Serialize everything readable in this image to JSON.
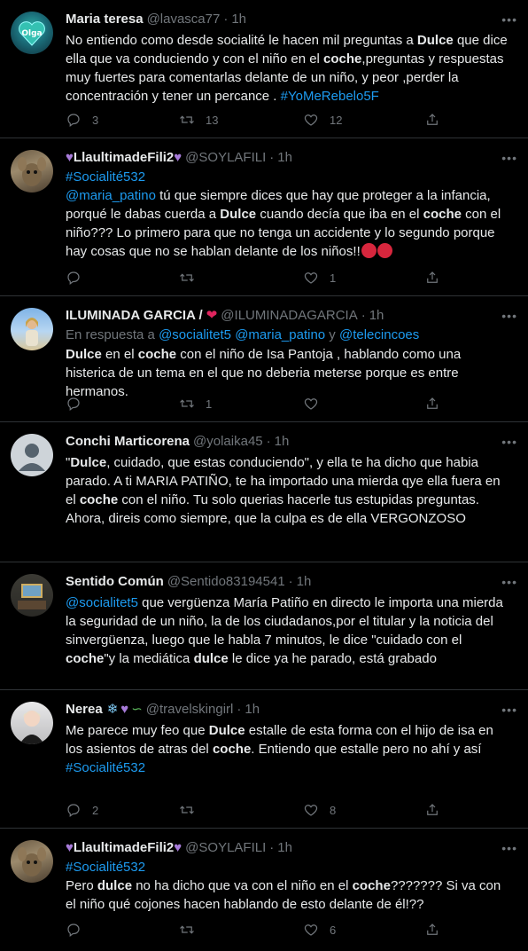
{
  "tweets": [
    {
      "name": "Maria teresa",
      "handle": "@lavasca77",
      "time": "1h",
      "reply_to": null,
      "text_parts": [
        {
          "t": "No entiendo como desde socialité le hacen mil preguntas a "
        },
        {
          "t": "Dulce",
          "b": true
        },
        {
          "t": " que dice ella que va conduciendo y con el niño en el "
        },
        {
          "t": "coche",
          "b": true
        },
        {
          "t": ",preguntas y respuestas muy fuertes para comentarlas delante de un niño, y peor ,perder la concentración y tener un percance . "
        },
        {
          "t": "#YoMeRebelo5F",
          "link": true
        }
      ],
      "replies": "3",
      "retweets": "13",
      "likes": "12"
    },
    {
      "name": "LlaultimadeFili2",
      "name_prefix_icon": "purple-heart",
      "name_suffix_icon": "purple-heart",
      "handle": "@SOYLAFILI",
      "time": "1h",
      "reply_to": null,
      "text_parts": [
        {
          "t": "#Socialité532",
          "link": true,
          "br": true
        },
        {
          "t": "@maria_patino",
          "link": true
        },
        {
          "t": " tú que siempre dices que hay que proteger a la infancia, porqué le dabas cuerda a "
        },
        {
          "t": "Dulce",
          "b": true
        },
        {
          "t": " cuando decía que iba en el "
        },
        {
          "t": "coche",
          "b": true
        },
        {
          "t": " con el niño??? Lo primero para que no tenga un accidente y lo segundo porque hay cosas que no se hablan delante de los niños!!"
        }
      ],
      "trailing_emoji": "angry-face x2",
      "replies": "",
      "retweets": "",
      "likes": "1"
    },
    {
      "name": "ILUMINADA GARCIA /",
      "name_suffix_icon": "red-heart",
      "handle": "@ILUMINADAGARCIA",
      "time": "1h",
      "reply_to": {
        "prefix": "En respuesta a ",
        "users": [
          "@socialitet5",
          "@maria_patino",
          "@telecincoes"
        ],
        "sep": " ",
        "and": " y "
      },
      "text_parts": [
        {
          "t": "Dulce",
          "b": true
        },
        {
          "t": " en el "
        },
        {
          "t": "coche",
          "b": true
        },
        {
          "t": " con el niño de Isa Pantoja , hablando como una histerica de un tema en el  que no deberia meterse porque es entre hermanos."
        }
      ],
      "replies": "",
      "retweets": "1",
      "likes": ""
    },
    {
      "name": "Conchi Marticorena",
      "handle": "@yolaika45",
      "time": "1h",
      "reply_to": null,
      "text_parts": [
        {
          "t": "\""
        },
        {
          "t": "Dulce",
          "b": true
        },
        {
          "t": ", cuidado, que estas conduciendo\", y ella te ha dicho que habia parado. A ti MARIA PATIÑO, te ha importado una mierda qye ella fuera en el "
        },
        {
          "t": "coche",
          "b": true
        },
        {
          "t": " con el niño. Tu solo querias hacerle tus estupidas preguntas. Ahora, direis como siempre, que la culpa es de ella  VERGONZOSO"
        }
      ],
      "replies": "",
      "retweets": "",
      "likes": ""
    },
    {
      "name": "Sentido Común",
      "handle": "@Sentido83194541",
      "time": "1h",
      "reply_to": null,
      "text_parts": [
        {
          "t": "@socialitet5",
          "link": true
        },
        {
          "t": " que vergüenza María Patiño en directo le importa una mierda la seguridad de un niño, la de los ciudadanos,por el titular y la noticia del sinvergüenza, luego que le habla 7 minutos, le dice \"cuidado con el "
        },
        {
          "t": "coche",
          "b": true
        },
        {
          "t": "\"y la mediática "
        },
        {
          "t": "dulce",
          "b": true
        },
        {
          "t": " le dice ya he parado, está grabado"
        }
      ],
      "replies": "",
      "retweets": "",
      "likes": ""
    },
    {
      "name": "Nerea",
      "name_suffix_icons": [
        "snowflake",
        "purple-heart",
        "green-lizard"
      ],
      "handle": "@travelskingirl",
      "time": "1h",
      "reply_to": null,
      "text_parts": [
        {
          "t": "Me parece muy feo que "
        },
        {
          "t": "Dulce",
          "b": true
        },
        {
          "t": " estalle de esta forma con el hijo de isa en los asientos de atras del "
        },
        {
          "t": "coche",
          "b": true
        },
        {
          "t": ". Entiendo que estalle pero no ahí y así",
          "br": true
        },
        {
          "t": "#Socialité532",
          "link": true
        }
      ],
      "replies": "2",
      "retweets": "",
      "likes": "8"
    },
    {
      "name": "LlaultimadeFili2",
      "name_prefix_icon": "purple-heart",
      "name_suffix_icon": "purple-heart",
      "handle": "@SOYLAFILI",
      "time": "1h",
      "reply_to": null,
      "text_parts": [
        {
          "t": "#Socialité532",
          "link": true,
          "br": true
        },
        {
          "t": "Pero "
        },
        {
          "t": "dulce",
          "b": true
        },
        {
          "t": " no ha dicho que va con el niño en el "
        },
        {
          "t": "coche",
          "b": true
        },
        {
          "t": "??????? Si va con el niño qué cojones hacen hablando de esto delante de él!??"
        }
      ],
      "replies": "",
      "retweets": "",
      "likes": "6"
    }
  ],
  "avatar_1_text": "Olga",
  "dot": "·",
  "colors": {
    "background": "#000000",
    "text": "#e7e9ea",
    "muted": "#71767b",
    "link": "#1d9bf0",
    "divider": "#2f3336",
    "purple_heart": "#a77bd9",
    "red_heart": "#e0245e"
  }
}
